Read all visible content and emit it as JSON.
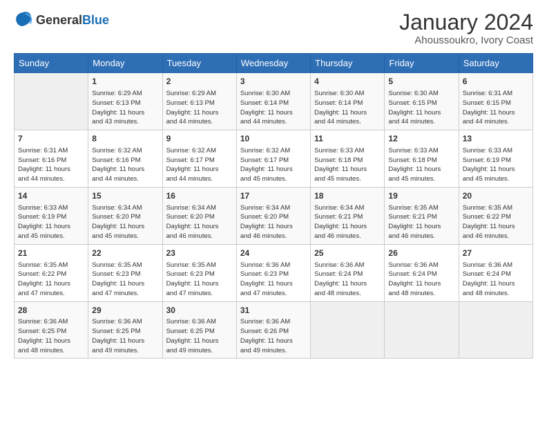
{
  "logo": {
    "general": "General",
    "blue": "Blue"
  },
  "title": "January 2024",
  "subtitle": "Ahoussoukro, Ivory Coast",
  "headers": [
    "Sunday",
    "Monday",
    "Tuesday",
    "Wednesday",
    "Thursday",
    "Friday",
    "Saturday"
  ],
  "weeks": [
    [
      {
        "day": "",
        "content": ""
      },
      {
        "day": "1",
        "content": "Sunrise: 6:29 AM\nSunset: 6:13 PM\nDaylight: 11 hours\nand 43 minutes."
      },
      {
        "day": "2",
        "content": "Sunrise: 6:29 AM\nSunset: 6:13 PM\nDaylight: 11 hours\nand 44 minutes."
      },
      {
        "day": "3",
        "content": "Sunrise: 6:30 AM\nSunset: 6:14 PM\nDaylight: 11 hours\nand 44 minutes."
      },
      {
        "day": "4",
        "content": "Sunrise: 6:30 AM\nSunset: 6:14 PM\nDaylight: 11 hours\nand 44 minutes."
      },
      {
        "day": "5",
        "content": "Sunrise: 6:30 AM\nSunset: 6:15 PM\nDaylight: 11 hours\nand 44 minutes."
      },
      {
        "day": "6",
        "content": "Sunrise: 6:31 AM\nSunset: 6:15 PM\nDaylight: 11 hours\nand 44 minutes."
      }
    ],
    [
      {
        "day": "7",
        "content": "Sunrise: 6:31 AM\nSunset: 6:16 PM\nDaylight: 11 hours\nand 44 minutes."
      },
      {
        "day": "8",
        "content": "Sunrise: 6:32 AM\nSunset: 6:16 PM\nDaylight: 11 hours\nand 44 minutes."
      },
      {
        "day": "9",
        "content": "Sunrise: 6:32 AM\nSunset: 6:17 PM\nDaylight: 11 hours\nand 44 minutes."
      },
      {
        "day": "10",
        "content": "Sunrise: 6:32 AM\nSunset: 6:17 PM\nDaylight: 11 hours\nand 45 minutes."
      },
      {
        "day": "11",
        "content": "Sunrise: 6:33 AM\nSunset: 6:18 PM\nDaylight: 11 hours\nand 45 minutes."
      },
      {
        "day": "12",
        "content": "Sunrise: 6:33 AM\nSunset: 6:18 PM\nDaylight: 11 hours\nand 45 minutes."
      },
      {
        "day": "13",
        "content": "Sunrise: 6:33 AM\nSunset: 6:19 PM\nDaylight: 11 hours\nand 45 minutes."
      }
    ],
    [
      {
        "day": "14",
        "content": "Sunrise: 6:33 AM\nSunset: 6:19 PM\nDaylight: 11 hours\nand 45 minutes."
      },
      {
        "day": "15",
        "content": "Sunrise: 6:34 AM\nSunset: 6:20 PM\nDaylight: 11 hours\nand 45 minutes."
      },
      {
        "day": "16",
        "content": "Sunrise: 6:34 AM\nSunset: 6:20 PM\nDaylight: 11 hours\nand 46 minutes."
      },
      {
        "day": "17",
        "content": "Sunrise: 6:34 AM\nSunset: 6:20 PM\nDaylight: 11 hours\nand 46 minutes."
      },
      {
        "day": "18",
        "content": "Sunrise: 6:34 AM\nSunset: 6:21 PM\nDaylight: 11 hours\nand 46 minutes."
      },
      {
        "day": "19",
        "content": "Sunrise: 6:35 AM\nSunset: 6:21 PM\nDaylight: 11 hours\nand 46 minutes."
      },
      {
        "day": "20",
        "content": "Sunrise: 6:35 AM\nSunset: 6:22 PM\nDaylight: 11 hours\nand 46 minutes."
      }
    ],
    [
      {
        "day": "21",
        "content": "Sunrise: 6:35 AM\nSunset: 6:22 PM\nDaylight: 11 hours\nand 47 minutes."
      },
      {
        "day": "22",
        "content": "Sunrise: 6:35 AM\nSunset: 6:23 PM\nDaylight: 11 hours\nand 47 minutes."
      },
      {
        "day": "23",
        "content": "Sunrise: 6:35 AM\nSunset: 6:23 PM\nDaylight: 11 hours\nand 47 minutes."
      },
      {
        "day": "24",
        "content": "Sunrise: 6:36 AM\nSunset: 6:23 PM\nDaylight: 11 hours\nand 47 minutes."
      },
      {
        "day": "25",
        "content": "Sunrise: 6:36 AM\nSunset: 6:24 PM\nDaylight: 11 hours\nand 48 minutes."
      },
      {
        "day": "26",
        "content": "Sunrise: 6:36 AM\nSunset: 6:24 PM\nDaylight: 11 hours\nand 48 minutes."
      },
      {
        "day": "27",
        "content": "Sunrise: 6:36 AM\nSunset: 6:24 PM\nDaylight: 11 hours\nand 48 minutes."
      }
    ],
    [
      {
        "day": "28",
        "content": "Sunrise: 6:36 AM\nSunset: 6:25 PM\nDaylight: 11 hours\nand 48 minutes."
      },
      {
        "day": "29",
        "content": "Sunrise: 6:36 AM\nSunset: 6:25 PM\nDaylight: 11 hours\nand 49 minutes."
      },
      {
        "day": "30",
        "content": "Sunrise: 6:36 AM\nSunset: 6:25 PM\nDaylight: 11 hours\nand 49 minutes."
      },
      {
        "day": "31",
        "content": "Sunrise: 6:36 AM\nSunset: 6:26 PM\nDaylight: 11 hours\nand 49 minutes."
      },
      {
        "day": "",
        "content": ""
      },
      {
        "day": "",
        "content": ""
      },
      {
        "day": "",
        "content": ""
      }
    ]
  ]
}
